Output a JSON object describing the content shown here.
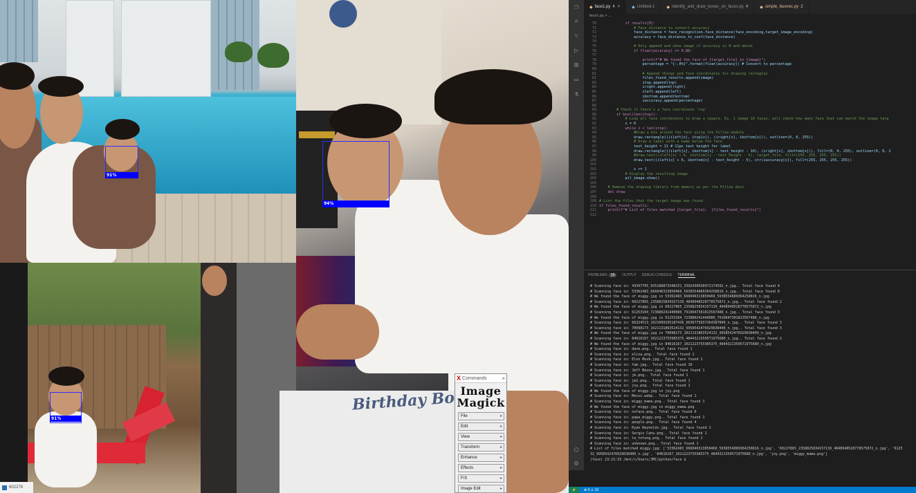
{
  "photos": {
    "pool": {
      "face_label": "91%"
    },
    "selfie": {
      "face_label": "94%"
    },
    "stroller": {
      "face_label": "91%"
    },
    "shirt": {
      "print_text": "Birthday Boy"
    }
  },
  "taskbar_stub": {
    "label": "602278"
  },
  "imagemagick": {
    "title": "Commands",
    "logo_line1": "Image",
    "logo_line2": "Magick",
    "menu": [
      {
        "label": "File"
      },
      {
        "label": "Edit"
      },
      {
        "label": "View"
      },
      {
        "label": "Transform"
      },
      {
        "label": "Enhance"
      },
      {
        "label": "Effects"
      },
      {
        "label": "F/X"
      },
      {
        "label": "Image Edit"
      }
    ]
  },
  "vscode": {
    "tabs": [
      {
        "label": "face1.py",
        "badge": "4",
        "active": true
      },
      {
        "label": "Untitled-1",
        "badge": "",
        "active": false
      },
      {
        "label": "identify_and_draw_boxes_on_faces.py",
        "badge": "4",
        "active": false
      },
      {
        "label": "simple_facerec.py",
        "badge": "2",
        "active": false
      }
    ],
    "breadcrumb": "face1.py > ...",
    "panel_tabs": {
      "problems": "PROBLEMS",
      "problems_count": "10",
      "output": "OUTPUT",
      "debug": "DEBUG CONSOLE",
      "terminal": "TERMINAL"
    },
    "code_lines": [
      {
        "n": "70",
        "t": "            if results[0]:"
      },
      {
        "n": "71",
        "t": "                # Face distance to convert accuracy"
      },
      {
        "n": "72",
        "t": "                face_distance = face_recognition.face_distance(face_encoding,target_image_encoding)"
      },
      {
        "n": "73",
        "t": "                accuracy = face_distance_to_conf(face_distance)"
      },
      {
        "n": "74",
        "t": ""
      },
      {
        "n": "75",
        "t": "                # Only append and show image if accuracy is N and above"
      },
      {
        "n": "76",
        "t": "                if float(accuracy) >= 0.88:"
      },
      {
        "n": "77",
        "t": ""
      },
      {
        "n": "78",
        "t": "                    print(f\"# We found the face of {target_file} in {image}\")"
      },
      {
        "n": "79",
        "t": "                    percentage = \"{:.0%}\".format(float(accuracy)) # Convert to percentage"
      },
      {
        "n": "80",
        "t": ""
      },
      {
        "n": "81",
        "t": "                    # Append things and face coordinates for drawing rectagles"
      },
      {
        "n": "82",
        "t": "                    files_found_results.append(image)"
      },
      {
        "n": "83",
        "t": "                    itop.append(top)"
      },
      {
        "n": "84",
        "t": "                    iright.append(right)"
      },
      {
        "n": "85",
        "t": "                    ileft.append(left)"
      },
      {
        "n": "86",
        "t": "                    ibottom.append(bottom)"
      },
      {
        "n": "87",
        "t": "                    iaccuracy.append(percentage)"
      },
      {
        "n": "88",
        "t": ""
      },
      {
        "n": "89",
        "t": "        # Check if there's a face coordinate 'top'"
      },
      {
        "n": "90",
        "t": "        if bool(len(itop)):"
      },
      {
        "n": "91",
        "t": "            # Loop all face coordinates to draw a square. Ex. 1 image 10 faces, will check how many face that can match the image targ"
      },
      {
        "n": "92",
        "t": "            x = 0"
      },
      {
        "n": "93",
        "t": "            while x < len(itop):"
      },
      {
        "n": "94",
        "t": "                #Draw a box around the face using the Pillow module"
      },
      {
        "n": "95",
        "t": "                draw.rectangle(((ileft[x], itop[x]), (iright[x], ibottom[x])), outline=(0, 0, 255))"
      },
      {
        "n": "96",
        "t": "                # Draw a label with a name below the face"
      },
      {
        "n": "97",
        "t": "                text_height = 11 # 11px text height for label"
      },
      {
        "n": "98",
        "t": "                draw.rectangle(((ileft[x], ibottom[x] - text_height - 10), (iright[x], ibottom[x])), fill=(0, 0, 255), outline=(0, 0, 2"
      },
      {
        "n": "99",
        "t": "                #draw.text((ileft[x] + 6, ibottom[x] - text_height - 5), target_file, fill=(255, 255, 255, 255))"
      },
      {
        "n": "100",
        "t": "                draw.text((ileft[x] + 6, ibottom[x] - text_height - 5), str(iaccuracy[x]), fill=(255, 255, 255, 255))"
      },
      {
        "n": "101",
        "t": ""
      },
      {
        "n": "102",
        "t": "                x += 1"
      },
      {
        "n": "103",
        "t": "            # Display the resulting image"
      },
      {
        "n": "104",
        "t": "            pil_image.show()"
      },
      {
        "n": "105",
        "t": ""
      },
      {
        "n": "106",
        "t": "    # Remove the drawing library from memory as per the Pillow docs"
      },
      {
        "n": "107",
        "t": "    del draw"
      },
      {
        "n": "108",
        "t": ""
      },
      {
        "n": "109",
        "t": "# List the files that the target image was found"
      },
      {
        "n": "110",
        "t": "if files_found_results:"
      },
      {
        "n": "111",
        "t": "    print(f\"# List of files matched {target_file}:  {files_found_results}\")"
      },
      {
        "n": "112",
        "t": ""
      }
    ],
    "terminal_lines": [
      "# Scanning face in: 49397705_935188873348151_3392430930072174592_n.jpg.. Total face found 4",
      "# Scanning face in: 53362483_666046313850460_5938554889364258816_n.jpg.. Total face found 8",
      "# We found the face of miggy.jpg in 53362483_666046313850460_5938554889364258816_n.jpg",
      "# Scanning face in: 60227865_2358825834157139_4848948528778575872_n.jpg.. Total face found 2",
      "# We found the face of miggy.jpg in 60227865_2358825834157139_4848948528778575872_n.jpg",
      "# Scanning face in: 61253104_723880241440080_7910647301813567488_n.jpg.. Total face found 3",
      "# We found the face of miggy.jpg in 61253104_723880241440080_7910647301813567488_n.jpg",
      "# Scanning face in: 66324513_1021099195187436_6636775837364387840_n.jpg.. Total face found 3",
      "# Scanning face in: 70098173_1021131863524132_9958542476929638400_n.jpg.. Total face found 3",
      "# We found the face of miggy.jpg in 70098173_1021131863524132_9958542476929638400_n.jpg",
      "# Scanning face in: 84616167_1021223755985375_4844321350571975680_n.jpg.. Total face found 2",
      "# We found the face of miggy.jpg in 84616167_1021223755985375_4844321350571975680_n.jpg",
      "# Scanning face in: dave.png.. Total face found 1",
      "# Scanning face in: elisa.png.. Total face found 1",
      "# Scanning face in: Elon Musk.jpg.. Total face found 1",
      "# Scanning face in: fam.jpg.. Total face found 10",
      "# Scanning face in: Jeff Bezos.jpg.. Total face found 1",
      "# Scanning face in: jm.png.. Total face found 1",
      "# Scanning face in: jm2.png.. Total face found 1",
      "# Scanning face in: joy.png.. Total face found 1",
      "# We found the face of miggy.jpg in joy.png",
      "# Scanning face in: Messi.webp.. Total face found 1",
      "# Scanning face in: miggy_mama.png.. Total face found 1",
      "# We found the face of miggy.jpg in miggy_mama.png",
      "# Scanning face in: noface.png.. Total face found 0",
      "# Scanning face in: papa_miggy.png.. Total face found 1",
      "# Scanning face in: people.png.. Total face found 4",
      "# Scanning face in: Ryan Reynolds.jpg.. Total face found 1",
      "# Scanning face in: Sergio Canu.png.. Total face found 1",
      "# Scanning face in: ta_totong.png.. Total face found 1",
      "# Scanning face in: unknown.png.. Total face found 1",
      "# List of files matched miggy.jpg: ['53362483_666046313850460_5938554889364258816_n.jpg', '60227865_2358825834157139_4848948528778575872_n.jpg', '6125",
      "32_9958542476929638400_n.jpg', '84616167_1021223755985375_4844321350571975680_n.jpg', 'joy.png', 'miggy_mama.png']",
      "(face) 23:22:33 /mnt/c/Users/JMC/python/face $ "
    ],
    "status": {
      "problems": "⊗ 0 ⚠ 10"
    }
  }
}
